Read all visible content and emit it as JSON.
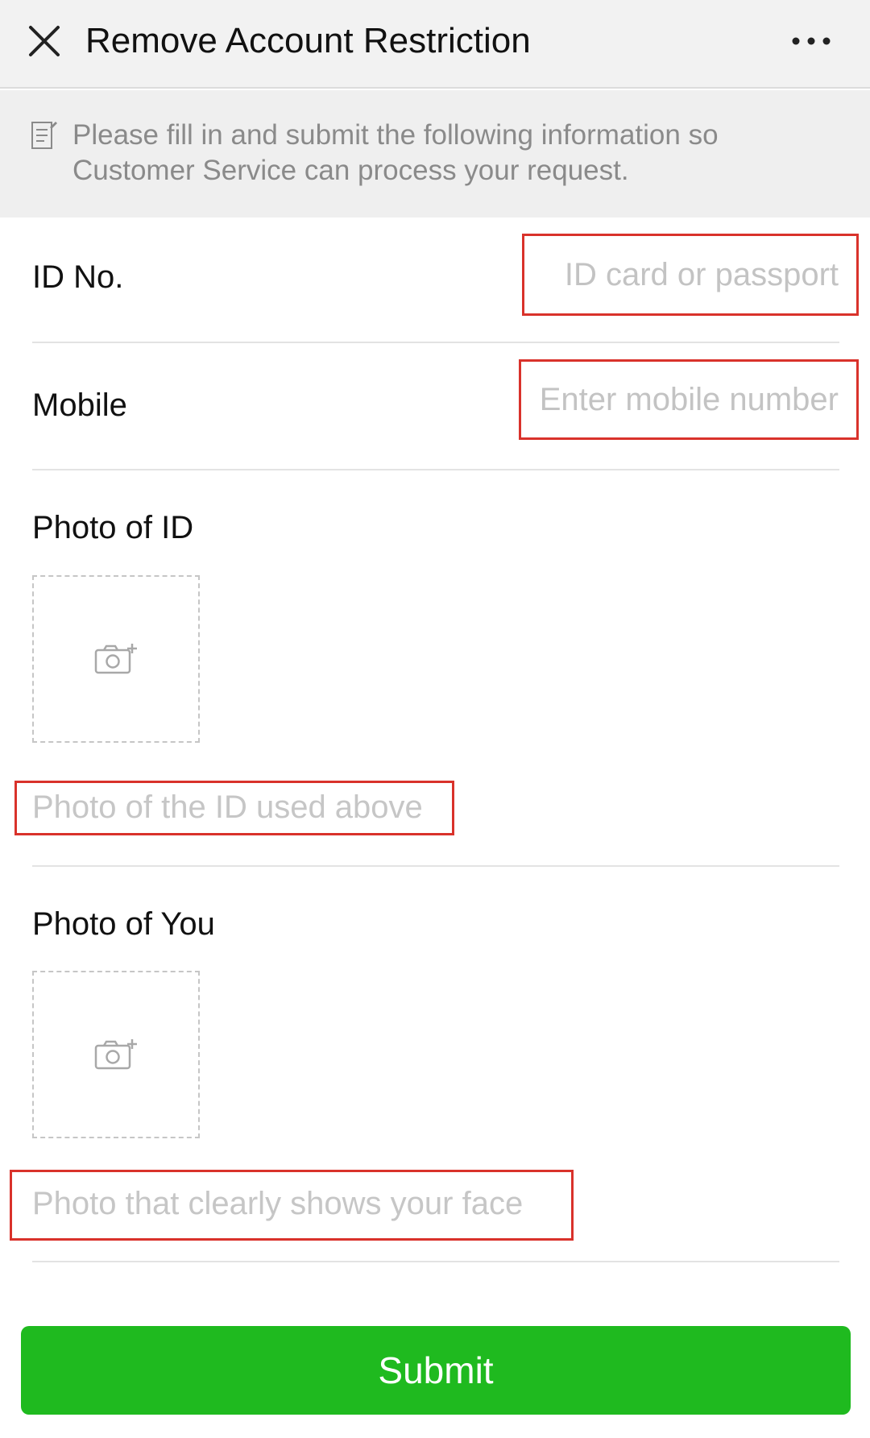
{
  "header": {
    "title": "Remove Account Restriction",
    "close_icon": "close-icon",
    "more_icon": "more-options-icon"
  },
  "notice": {
    "icon": "document-edit-icon",
    "text": "Please fill in and submit the following information so Customer Service can process your request."
  },
  "form": {
    "id_no": {
      "label": "ID No.",
      "placeholder": "ID card or passport",
      "value": ""
    },
    "mobile": {
      "label": "Mobile",
      "placeholder": "Enter mobile number",
      "value": ""
    },
    "photo_id": {
      "label": "Photo of ID",
      "hint": "Photo of the ID used above",
      "icon": "add-photo-camera-icon"
    },
    "photo_you": {
      "label": "Photo of You",
      "hint": "Photo that clearly shows your face",
      "icon": "add-photo-camera-icon"
    }
  },
  "submit_label": "Submit",
  "colors": {
    "accent_green": "#1fba1f",
    "highlight_red": "#d9322b",
    "header_bg": "#f2f2f2",
    "placeholder_grey": "#c3c3c3"
  }
}
